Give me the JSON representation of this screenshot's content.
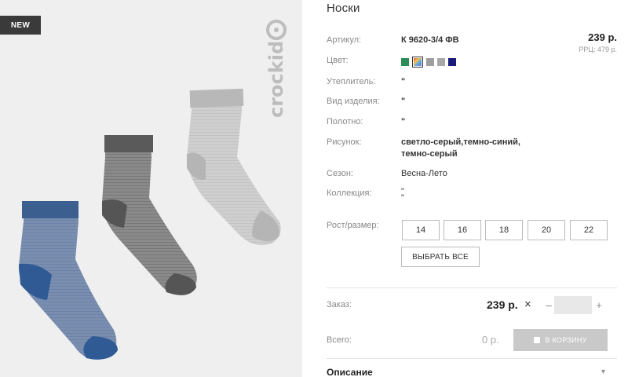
{
  "image": {
    "badge": "NEW",
    "brand": "crockid"
  },
  "product": {
    "title": "Носки",
    "price": "239 р.",
    "rrp": "РРЦ: 479 р."
  },
  "attributes": {
    "article_label": "Артикул:",
    "article_value": "К 9620-3/4 ФВ",
    "color_label": "Цвет:",
    "insulation_label": "Утеплитель:",
    "insulation_value": "\"",
    "type_label": "Вид изделия:",
    "type_value": "\"",
    "fabric_label": "Полотно:",
    "fabric_value": "\"",
    "pattern_label": "Рисунок:",
    "pattern_line1": "светло-серый,темно-синий,",
    "pattern_line2": "темно-серый",
    "season_label": "Сезон:",
    "season_value": "Весна-Лето",
    "collection_label": "Коллекция:",
    "collection_line1": "\"",
    "collection_line2": "\""
  },
  "swatches": [
    {
      "color": "#2e8b57",
      "selected": false
    },
    {
      "color": "#e0a84e",
      "selected": true
    },
    {
      "color": "#9e9e9e",
      "selected": false
    },
    {
      "color": "#a8a8a8",
      "selected": false
    },
    {
      "color": "#1a1a7a",
      "selected": false
    }
  ],
  "sizes": {
    "label": "Рост/размер:",
    "options": [
      "14",
      "16",
      "18",
      "20",
      "22"
    ],
    "select_all": "ВЫБРАТЬ ВСЕ"
  },
  "order": {
    "label": "Заказ:",
    "price": "239 р.",
    "times": "×",
    "minus": "–",
    "plus": "+",
    "quantity": ""
  },
  "total": {
    "label": "Всего:",
    "value": "0 р.",
    "cart_button": "В КОРЗИНУ"
  },
  "description": {
    "title": "Описание"
  }
}
